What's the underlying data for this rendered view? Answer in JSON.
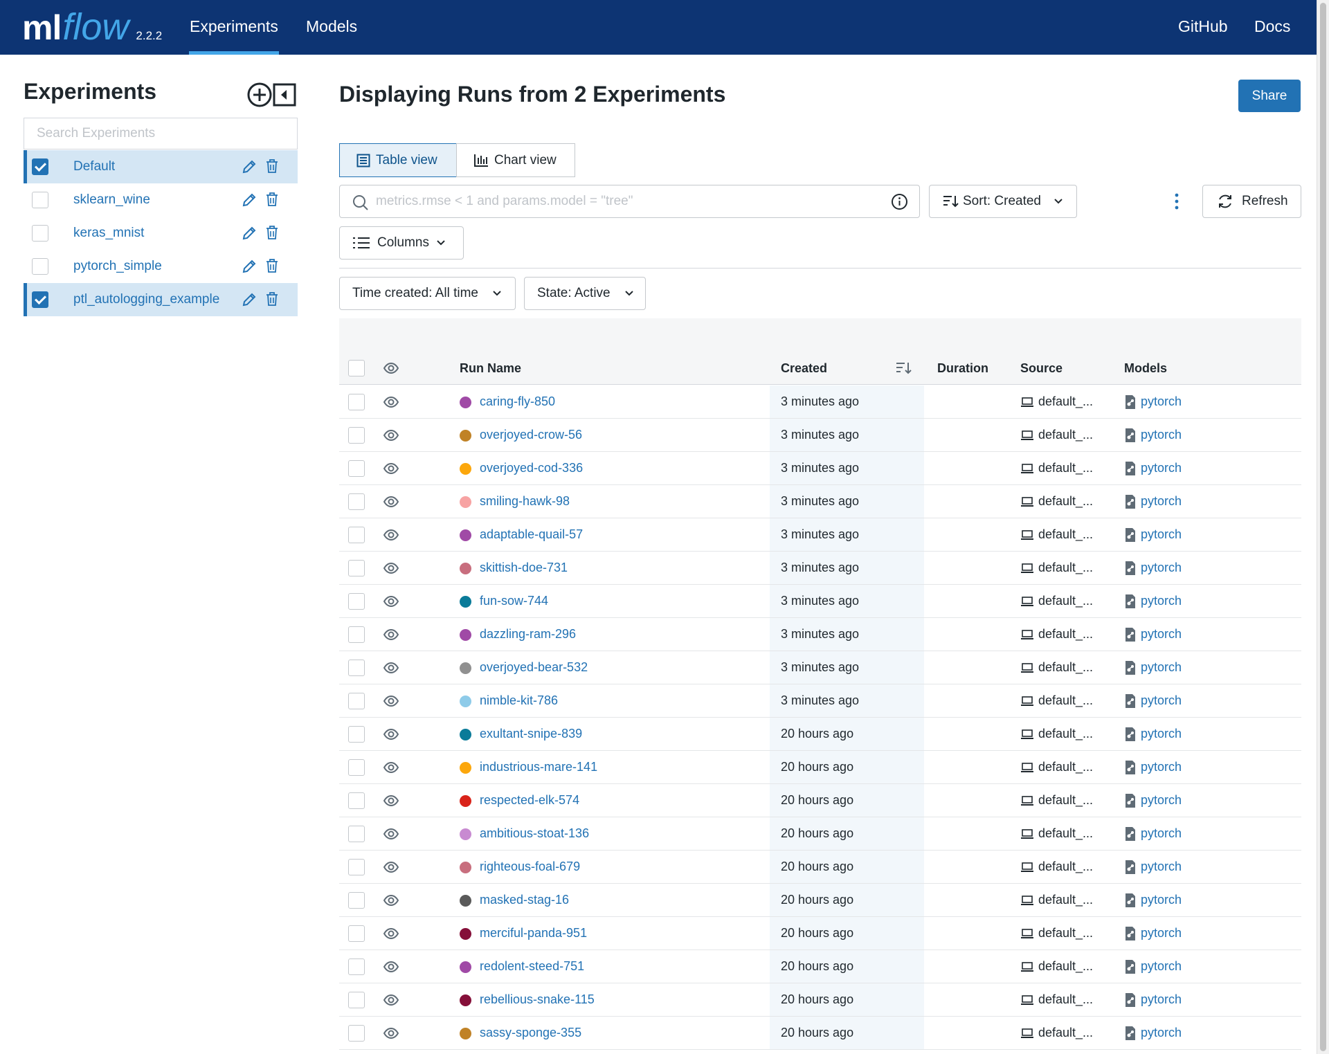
{
  "nav": {
    "logo_ml": "ml",
    "logo_flow": "flow",
    "version": "2.2.2",
    "experiments": "Experiments",
    "models": "Models",
    "github": "GitHub",
    "docs": "Docs"
  },
  "sidebar": {
    "title": "Experiments",
    "search_placeholder": "Search Experiments",
    "experiments": [
      {
        "name": "Default",
        "checked": true
      },
      {
        "name": "sklearn_wine",
        "checked": false
      },
      {
        "name": "keras_mnist",
        "checked": false
      },
      {
        "name": "pytorch_simple",
        "checked": false
      },
      {
        "name": "ptl_autologging_example",
        "checked": true
      }
    ]
  },
  "main": {
    "title": "Displaying Runs from 2 Experiments",
    "share": "Share",
    "table_view": "Table view",
    "chart_view": "Chart view",
    "search_placeholder": "metrics.rmse < 1 and params.model = \"tree\"",
    "sort": "Sort: Created",
    "refresh": "Refresh",
    "columns": "Columns",
    "time_filter": "Time created: All time",
    "state_filter": "State: Active"
  },
  "table": {
    "headers": {
      "run_name": "Run Name",
      "created": "Created",
      "duration": "Duration",
      "source": "Source",
      "models": "Models"
    },
    "rows": [
      {
        "name": "caring-fly-850",
        "color": "#a04aa6",
        "created": "3 minutes ago",
        "source": "default_...",
        "model": "pytorch"
      },
      {
        "name": "overjoyed-crow-56",
        "color": "#c08226",
        "created": "3 minutes ago",
        "source": "default_...",
        "model": "pytorch"
      },
      {
        "name": "overjoyed-cod-336",
        "color": "#fca70c",
        "created": "3 minutes ago",
        "source": "default_...",
        "model": "pytorch"
      },
      {
        "name": "smiling-hawk-98",
        "color": "#f7a3a3",
        "created": "3 minutes ago",
        "source": "default_...",
        "model": "pytorch"
      },
      {
        "name": "adaptable-quail-57",
        "color": "#a04aa6",
        "created": "3 minutes ago",
        "source": "default_...",
        "model": "pytorch"
      },
      {
        "name": "skittish-doe-731",
        "color": "#c86e7e",
        "created": "3 minutes ago",
        "source": "default_...",
        "model": "pytorch"
      },
      {
        "name": "fun-sow-744",
        "color": "#0a7b99",
        "created": "3 minutes ago",
        "source": "default_...",
        "model": "pytorch"
      },
      {
        "name": "dazzling-ram-296",
        "color": "#a04aa6",
        "created": "3 minutes ago",
        "source": "default_...",
        "model": "pytorch"
      },
      {
        "name": "overjoyed-bear-532",
        "color": "#909090",
        "created": "3 minutes ago",
        "source": "default_...",
        "model": "pytorch"
      },
      {
        "name": "nimble-kit-786",
        "color": "#8ecbe9",
        "created": "3 minutes ago",
        "source": "default_...",
        "model": "pytorch"
      },
      {
        "name": "exultant-snipe-839",
        "color": "#0a7b99",
        "created": "20 hours ago",
        "source": "default_...",
        "model": "pytorch"
      },
      {
        "name": "industrious-mare-141",
        "color": "#fca70c",
        "created": "20 hours ago",
        "source": "default_...",
        "model": "pytorch"
      },
      {
        "name": "respected-elk-574",
        "color": "#d9231a",
        "created": "20 hours ago",
        "source": "default_...",
        "model": "pytorch"
      },
      {
        "name": "ambitious-stoat-136",
        "color": "#c88ad1",
        "created": "20 hours ago",
        "source": "default_...",
        "model": "pytorch"
      },
      {
        "name": "righteous-foal-679",
        "color": "#c86e7e",
        "created": "20 hours ago",
        "source": "default_...",
        "model": "pytorch"
      },
      {
        "name": "masked-stag-16",
        "color": "#5a5a5a",
        "created": "20 hours ago",
        "source": "default_...",
        "model": "pytorch"
      },
      {
        "name": "merciful-panda-951",
        "color": "#850f39",
        "created": "20 hours ago",
        "source": "default_...",
        "model": "pytorch"
      },
      {
        "name": "redolent-steed-751",
        "color": "#a04aa6",
        "created": "20 hours ago",
        "source": "default_...",
        "model": "pytorch"
      },
      {
        "name": "rebellious-snake-115",
        "color": "#850f39",
        "created": "20 hours ago",
        "source": "default_...",
        "model": "pytorch"
      },
      {
        "name": "sassy-sponge-355",
        "color": "#c08226",
        "created": "20 hours ago",
        "source": "default_...",
        "model": "pytorch"
      }
    ]
  }
}
